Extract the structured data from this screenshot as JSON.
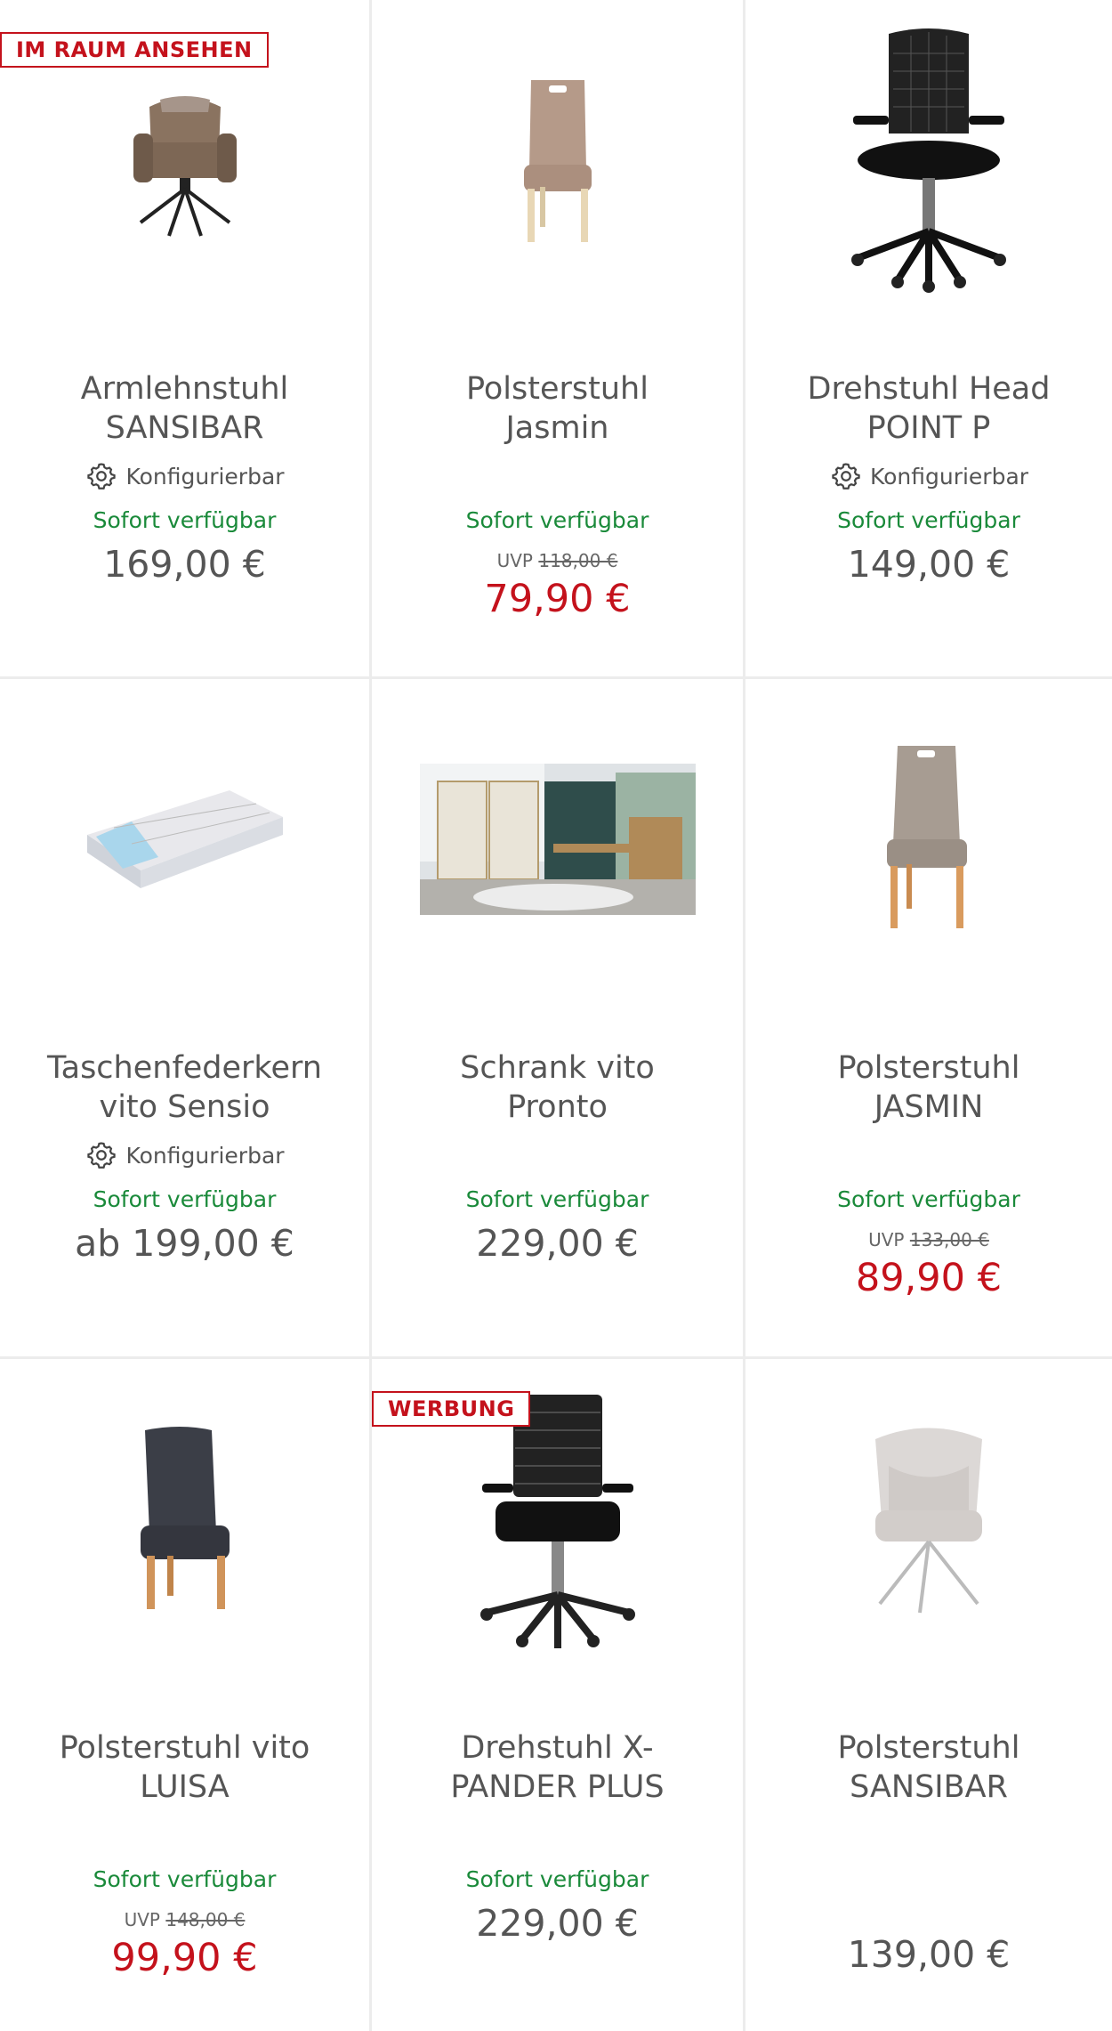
{
  "badges": {
    "first": "IM RAUM ANSEHEN",
    "second": "WERBUNG"
  },
  "colors": {
    "availability": "#1a8a3a",
    "sale_price": "#c4121c",
    "badge": "#c4121c",
    "text": "#555555",
    "divider": "#ececec"
  },
  "products": [
    {
      "title_l1": "Armlehnstuhl",
      "title_l2": "SANSIBAR",
      "configurable": "Konfigurierbar",
      "availability": "Sofort verfügbar",
      "price": "169,00 €"
    },
    {
      "title_l1": "Polsterstuhl",
      "title_l2": "Jasmin",
      "availability": "Sofort verfügbar",
      "uvp_label": "UVP",
      "uvp_price": "118,00 €",
      "sale_price": "79,90 €"
    },
    {
      "title_l1": "Drehstuhl Head",
      "title_l2": "POINT P",
      "configurable": "Konfigurierbar",
      "availability": "Sofort verfügbar",
      "price": "149,00 €"
    },
    {
      "title_l1": "Taschenfederkern",
      "title_l2": "vito Sensio",
      "configurable": "Konfigurierbar",
      "availability": "Sofort verfügbar",
      "price": "ab 199,00 €"
    },
    {
      "title_l1": "Schrank vito",
      "title_l2": "Pronto",
      "availability": "Sofort verfügbar",
      "price": "229,00 €"
    },
    {
      "title_l1": "Polsterstuhl",
      "title_l2": "JASMIN",
      "availability": "Sofort verfügbar",
      "uvp_label": "UVP",
      "uvp_price": "133,00 €",
      "sale_price": "89,90 €"
    },
    {
      "title_l1": "Polsterstuhl vito",
      "title_l2": "LUISA",
      "availability": "Sofort verfügbar",
      "uvp_label": "UVP",
      "uvp_price": "148,00 €",
      "sale_price": "99,90 €"
    },
    {
      "title_l1": "Drehstuhl X-",
      "title_l2": "PANDER PLUS",
      "availability": "Sofort verfügbar",
      "price": "229,00 €"
    },
    {
      "title_l1": "Polsterstuhl",
      "title_l2": "SANSIBAR",
      "price": "139,00 €"
    }
  ]
}
